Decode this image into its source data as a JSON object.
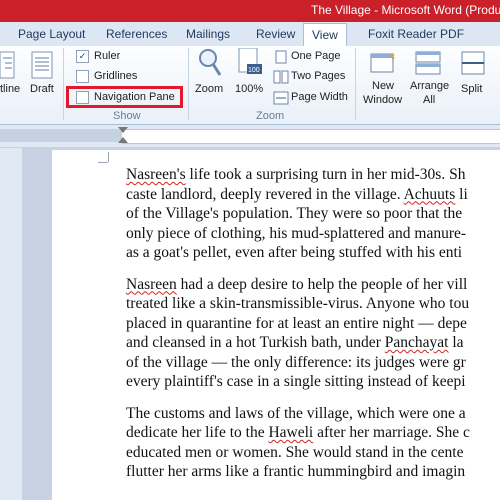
{
  "window": {
    "title": "The Village - Microsoft Word (Produ"
  },
  "tabs": [
    {
      "label": "Page Layout"
    },
    {
      "label": "References"
    },
    {
      "label": "Mailings"
    },
    {
      "label": "Review"
    },
    {
      "label": "View",
      "active": true
    },
    {
      "label": "Foxit Reader PDF"
    }
  ],
  "ribbon": {
    "views": {
      "outline_partial": "tline",
      "draft": "Draft"
    },
    "show": {
      "group_label": "Show",
      "ruler": {
        "label": "Ruler",
        "checked": true
      },
      "gridlines": {
        "label": "Gridlines",
        "checked": false
      },
      "navigation_pane": {
        "label": "Navigation Pane",
        "checked": false
      }
    },
    "zoom": {
      "group_label": "Zoom",
      "zoom_label": "Zoom",
      "hundred_label": "100%",
      "one_page": "One Page",
      "two_pages": "Two Pages",
      "page_width": "Page Width"
    },
    "window": {
      "new_window": [
        "New",
        "Window"
      ],
      "arrange_all": [
        "Arrange",
        "All"
      ],
      "split": "Split"
    }
  },
  "document": {
    "paragraphs": [
      [
        [
          {
            "t": "Nasreen's",
            "sq": true
          },
          {
            "t": " life took a surprising turn in her mid-30s. Sh"
          }
        ],
        [
          {
            "t": "caste landlord, deeply revered in the village. "
          },
          {
            "t": "Achuuts",
            "sq": true
          },
          {
            "t": " li"
          }
        ],
        [
          {
            "t": "of the Village's population. They were so poor that the"
          }
        ],
        [
          {
            "t": "only piece of clothing, his mud-splattered and manure-"
          }
        ],
        [
          {
            "t": "as a goat's pellet, even after being stuffed with his enti"
          }
        ]
      ],
      [
        [
          {
            "t": "Nasreen",
            "sq": true
          },
          {
            "t": " had a deep desire to help the people of her vill"
          }
        ],
        [
          {
            "t": "treated like a skin-transmissible-virus. Anyone who tou"
          }
        ],
        [
          {
            "t": "placed in quarantine for at least an entire night — depe"
          }
        ],
        [
          {
            "t": "and cleansed in a hot Turkish bath, under "
          },
          {
            "t": "Panchayat",
            "sq": true
          },
          {
            "t": " la"
          }
        ],
        [
          {
            "t": "of the village — the only difference: its judges were gr"
          }
        ],
        [
          {
            "t": "every plaintiff's case in a single sitting instead of keepi"
          }
        ]
      ],
      [
        [
          {
            "t": "The customs and laws of the village, which were one a"
          }
        ],
        [
          {
            "t": "dedicate her life to the "
          },
          {
            "t": "Haweli",
            "sq": true
          },
          {
            "t": " after her marriage. She c"
          }
        ],
        [
          {
            "t": "educated men or women. She would stand in the cente"
          }
        ],
        [
          {
            "t": "flutter her arms like a frantic hummingbird and imagin"
          }
        ]
      ]
    ]
  },
  "colors": {
    "titlebar": "#c9202a",
    "highlight": "#e3182d",
    "ribbon_text": "#1e395b"
  }
}
